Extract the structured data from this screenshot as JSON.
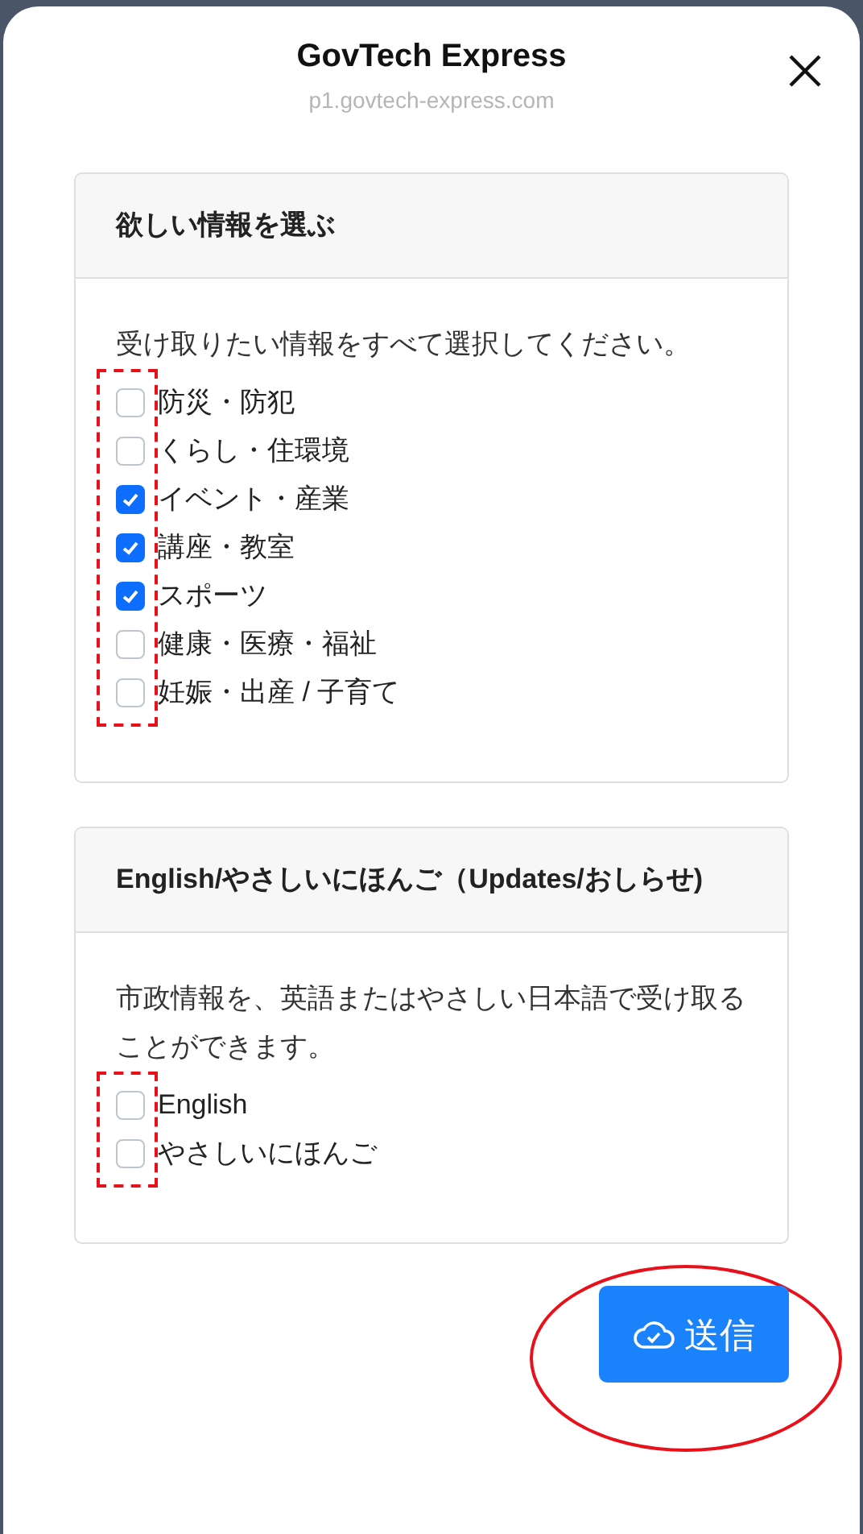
{
  "header": {
    "title": "GovTech Express",
    "subtitle": "p1.govtech-express.com"
  },
  "sections": [
    {
      "title": "欲しい情報を選ぶ",
      "description": "受け取りたい情報をすべて選択してください。",
      "options": [
        {
          "label": "防災・防犯",
          "checked": false
        },
        {
          "label": "くらし・住環境",
          "checked": false
        },
        {
          "label": "イベント・産業",
          "checked": true
        },
        {
          "label": "講座・教室",
          "checked": true
        },
        {
          "label": "スポーツ",
          "checked": true
        },
        {
          "label": "健康・医療・福祉",
          "checked": false
        },
        {
          "label": "妊娠・出産 / 子育て",
          "checked": false
        }
      ]
    },
    {
      "title": "English/やさしいにほんご（Updates/おしらせ)",
      "description": "市政情報を、英語またはやさしい日本語で受け取ることができます。",
      "options": [
        {
          "label": "English",
          "checked": false
        },
        {
          "label": "やさしいにほんご",
          "checked": false
        }
      ]
    }
  ],
  "submit": {
    "label": "送信"
  }
}
